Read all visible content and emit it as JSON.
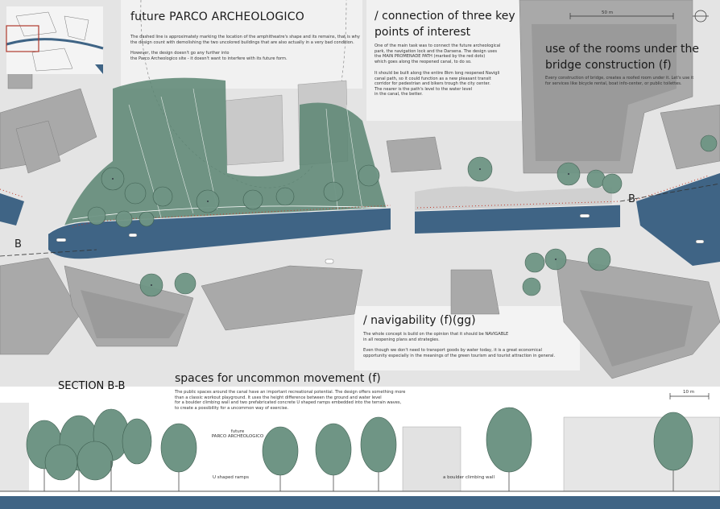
{
  "headings": {
    "parco": "future PARCO ARCHEOLOGICO",
    "connection_l1": "/ connection of three key",
    "connection_l2": "points of interest",
    "rooms_l1": "use of the rooms under the",
    "rooms_l2": "bridge construction (f)",
    "navigability": "/ navigability (f)(gg)",
    "section": "SECTION B-B",
    "spaces": "spaces for uncommon movement (f)"
  },
  "paragraphs": {
    "parco_1a": "The dashed line is approximately marking the location of the amphitheatre's shape and its remains, that is why",
    "parco_1b": "the design count with demolishing the two uncolored buildings that are also actually in a very bad condition.",
    "parco_2a": "However, the design doesn't go any further into",
    "parco_2b": "the Parco Archeologico site - it doesn't want to interfere with its future form.",
    "conn_1a": "One of the main task was to connect the future archeological",
    "conn_1b": "park, the navigation lock and the Darsena. The design uses",
    "conn_1c": "the MAIN PROMENADE PATH (marked by the red dots)",
    "conn_1d": "which goes along the reopened canal, to do so.",
    "conn_2a": "It should be built along the entire 8km long reopened Navigli",
    "conn_2b": "canal path, so it could function as a new pleasant transit",
    "conn_2c": "corridor for pedestrian and bikers trough the city center.",
    "conn_2d": "The nearer is the path's level to the water level",
    "conn_2e": "in the canal, the better.",
    "rooms_1a": "Every construction of bridge, creates a roofed room under it. Let's use it",
    "rooms_1b": "for services like bicycle rental, boat info-center, or public toilettes.",
    "nav_1a": "The whole concept is build on the opinion that it should be NAVIGABLE",
    "nav_1b": "in all reopening plans and strategies.",
    "nav_2a": "Even though we don't need to transport goods by water today, it is a great economical",
    "nav_2b": "opportunity especially in the meanings of the green tourism and tourist attraction in general.",
    "spaces_1a": "The public spaces  around the canal have an important recreational potential. The design offers something more",
    "spaces_1b": "than a classic workout playground. It uses the height difference between the ground and water level",
    "spaces_1c": "for a boulder climbing wall and two prefabricated concrete U shaped ramps embedded into the terrain waves,",
    "spaces_1d": "to create a possibility for a uncommon way of exercise."
  },
  "labels": {
    "scale_plan": "50 m",
    "scale_section": "10 m",
    "section_mark_left": "B",
    "section_mark_right": "B",
    "section_future_1": "future",
    "section_future_2": "PARCO ARCHEOLOGICO",
    "section_ramps": "U shaped ramps",
    "section_wall": "a boulder climbing wall"
  },
  "colors": {
    "water": "#3f6485",
    "vegetation": "#4f7a67",
    "tree": "#6f9585",
    "building": "#a8a8a8",
    "building_shadow": "#8c8c8c",
    "street": "#dcdcdc",
    "path_dots": "#c0392b",
    "locator_frame": "#b03a2e"
  },
  "icons": {
    "north_arrow": "north-arrow-icon"
  }
}
